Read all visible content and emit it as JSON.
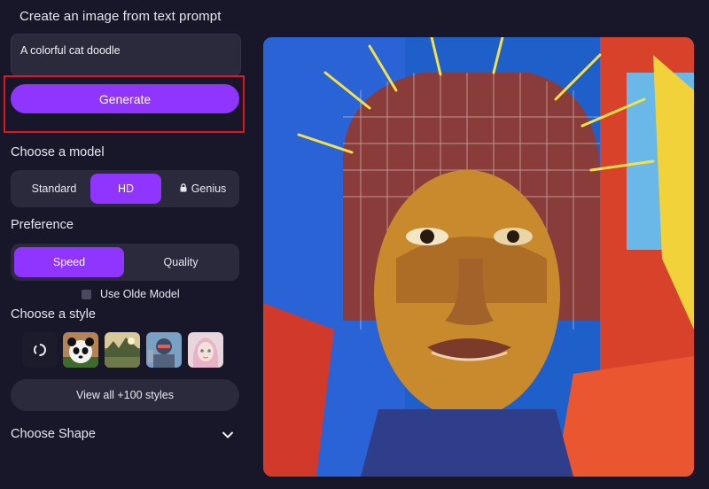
{
  "header": {
    "title": "Create an image from text prompt"
  },
  "prompt": {
    "value": "A colorful cat doodle"
  },
  "generate": {
    "label": "Generate"
  },
  "model": {
    "label": "Choose a model",
    "options": [
      "Standard",
      "HD",
      "Genius"
    ],
    "selected": "HD",
    "genius_icon": "lock-icon"
  },
  "preference": {
    "label": "Preference",
    "options": [
      "Speed",
      "Quality"
    ],
    "selected": "Speed"
  },
  "olde_model": {
    "label": "Use Olde Model",
    "checked": false
  },
  "style": {
    "label": "Choose a style",
    "thumbnails": [
      "no-style",
      "panda",
      "landscape",
      "robot",
      "anime-girl"
    ],
    "view_all": "View all +100 styles"
  },
  "shape": {
    "label": "Choose Shape",
    "icon": "chevron-down-icon"
  },
  "colors": {
    "accent": "#8f35ff",
    "background": "#181629",
    "panel": "#2b2a3d",
    "highlight": "#e0161c"
  }
}
